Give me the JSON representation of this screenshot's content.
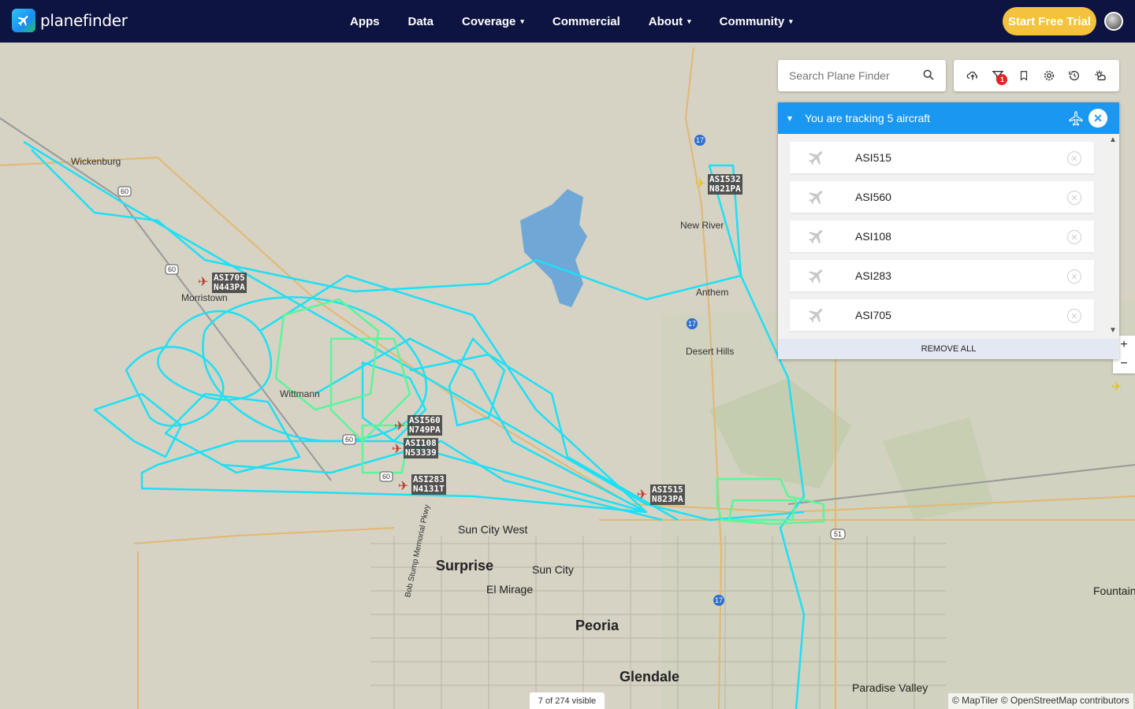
{
  "brand": {
    "name": "planefinder"
  },
  "nav": [
    {
      "label": "Apps",
      "dropdown": false
    },
    {
      "label": "Data",
      "dropdown": false
    },
    {
      "label": "Coverage",
      "dropdown": true
    },
    {
      "label": "Commercial",
      "dropdown": false
    },
    {
      "label": "About",
      "dropdown": true
    },
    {
      "label": "Community",
      "dropdown": true
    }
  ],
  "trial_button": "Start Free Trial",
  "search": {
    "placeholder": "Search Plane Finder"
  },
  "toolbar": {
    "icons": [
      "cloud-upload-icon",
      "filter-icon",
      "bookmark-icon",
      "settings-icon",
      "history-icon",
      "weather-icon"
    ],
    "filter_badge": "1"
  },
  "tracking": {
    "title": "You are tracking 5 aircraft",
    "items": [
      {
        "callsign": "ASI515"
      },
      {
        "callsign": "ASI560"
      },
      {
        "callsign": "ASI108"
      },
      {
        "callsign": "ASI283"
      },
      {
        "callsign": "ASI705"
      }
    ],
    "remove_all": "REMOVE ALL"
  },
  "zoom": {
    "in": "+",
    "out": "−"
  },
  "map": {
    "places": [
      {
        "name": "Wickenburg",
        "size": "small"
      },
      {
        "name": "Morristown",
        "size": "small"
      },
      {
        "name": "Wittmann",
        "size": "small"
      },
      {
        "name": "New River",
        "size": "small"
      },
      {
        "name": "Anthem",
        "size": "small"
      },
      {
        "name": "Desert Hills",
        "size": "small"
      },
      {
        "name": "Sun City West",
        "size": "town"
      },
      {
        "name": "Surprise",
        "size": "city"
      },
      {
        "name": "Sun City",
        "size": "town"
      },
      {
        "name": "El Mirage",
        "size": "town"
      },
      {
        "name": "Peoria",
        "size": "city"
      },
      {
        "name": "Glendale",
        "size": "city"
      },
      {
        "name": "Paradise Valley",
        "size": "town"
      },
      {
        "name": "Fountain",
        "size": "town"
      },
      {
        "name": "Bob Stump Memorial Pkwy",
        "size": "small"
      }
    ],
    "aircraft": [
      {
        "callsign": "ASI705",
        "reg": "N443PA",
        "color": "#c0392b"
      },
      {
        "callsign": "ASI560",
        "reg": "N749PA",
        "color": "#c0392b"
      },
      {
        "callsign": "ASI108",
        "reg": "N53339",
        "color": "#c0392b"
      },
      {
        "callsign": "ASI283",
        "reg": "N4131T",
        "color": "#c0392b"
      },
      {
        "callsign": "ASI515",
        "reg": "N823PA",
        "color": "#c0392b"
      },
      {
        "callsign": "ASI532",
        "reg": "N821PA",
        "color": "#e8c31a"
      }
    ],
    "shields": [
      "17",
      "60",
      "51"
    ],
    "colors": {
      "track": "#1de0f5",
      "track_low": "#5cf59a",
      "water": "#6fa8d6"
    }
  },
  "visible_count": "7 of 274 visible",
  "attribution": "© MapTiler © OpenStreetMap contributors"
}
